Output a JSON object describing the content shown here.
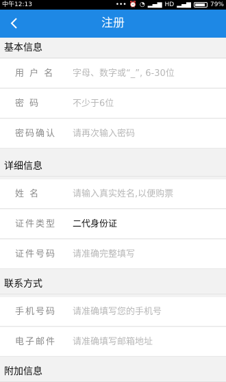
{
  "status": {
    "time": "中午12:13",
    "network": "HD",
    "battery": "79%"
  },
  "header": {
    "title": "注册"
  },
  "sections": {
    "basic": {
      "title": "基本信息",
      "rows": [
        {
          "label": "用 户 名",
          "placeholder": "字母、数字或“_”, 6-30位"
        },
        {
          "label": "密    码",
          "placeholder": "不少于6位"
        },
        {
          "label": "密码确认",
          "placeholder": "请再次输入密码"
        }
      ]
    },
    "detail": {
      "title": "详细信息",
      "rows": [
        {
          "label": "姓    名",
          "placeholder": "请输入真实姓名,以便购票"
        },
        {
          "label": "证件类型",
          "value": "二代身份证"
        },
        {
          "label": "证件号码",
          "placeholder": "请准确完整填写"
        }
      ]
    },
    "contact": {
      "title": "联系方式",
      "rows": [
        {
          "label": "手机号码",
          "placeholder": "请准确填写您的手机号"
        },
        {
          "label": "电子邮件",
          "placeholder": "请准确填写邮箱地址"
        }
      ]
    },
    "extra": {
      "title": "附加信息"
    }
  },
  "colors": {
    "header": "#1e88e5",
    "background": "#f2f2f2"
  }
}
